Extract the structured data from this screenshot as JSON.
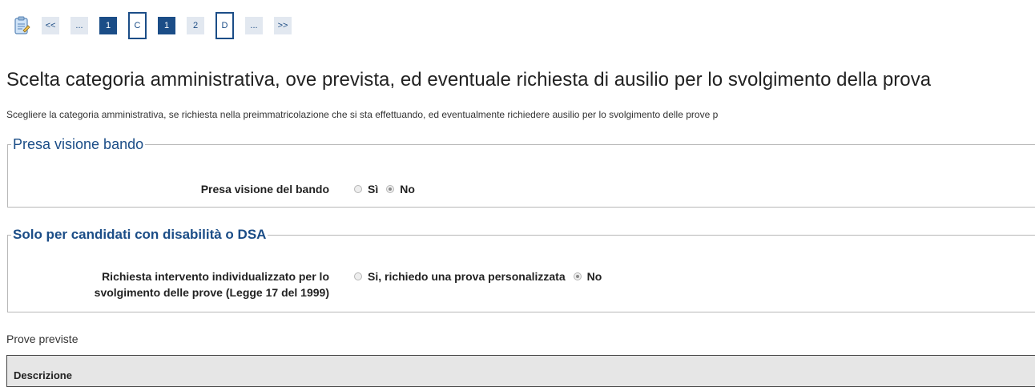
{
  "steps": {
    "first": "<<",
    "prev_ellipsis": "...",
    "s1": "1",
    "c": "C",
    "s1_active": "1",
    "s2": "2",
    "d": "D",
    "next_ellipsis": "...",
    "last": ">>"
  },
  "page": {
    "title": "Scelta categoria amministrativa, ove prevista, ed eventuale richiesta di ausilio per lo svolgimento della prova",
    "description": "Scegliere la categoria amministrativa, se richiesta nella preimmatricolazione che si sta effettuando, ed eventualmente richiedere ausilio per lo svolgimento delle prove p"
  },
  "bando": {
    "legend": "Presa visione bando",
    "label": "Presa visione del bando",
    "options": [
      "Sì",
      "No"
    ],
    "selected": "No"
  },
  "disabilita": {
    "legend": "Solo per candidati con disabilità o DSA",
    "label_line1": "Richiesta intervento individualizzato per lo",
    "label_line2": "svolgimento delle prove (Legge 17 del 1999)",
    "options": [
      "Si, richiedo una prova personalizzata",
      "No"
    ],
    "selected": "No"
  },
  "prove": {
    "label": "Prove previste",
    "table_header": "Descrizione"
  },
  "colors": {
    "accent": "#1b4d87",
    "step_light": "#e2e8f0"
  }
}
